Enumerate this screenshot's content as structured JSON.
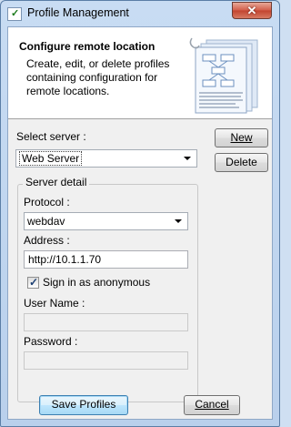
{
  "window": {
    "title": "Profile Management",
    "close_symbol": "✕"
  },
  "header": {
    "title": "Configure remote location",
    "description_lines": [
      "Create, edit, or delete profiles",
      "containing configuration for",
      "remote locations."
    ]
  },
  "server": {
    "label": "Select server :",
    "selected": "Web Server"
  },
  "buttons": {
    "new": "New",
    "delete": "Delete",
    "save": "Save Profiles",
    "cancel": "Cancel"
  },
  "server_detail": {
    "group_label": "Server detail",
    "protocol_label": "Protocol :",
    "protocol_value": "webdav",
    "address_label": "Address :",
    "address_value": "http://10.1.1.70",
    "anonymous_label": "Sign in as anonymous",
    "anonymous_checked": true,
    "username_label": "User Name :",
    "username_value": "",
    "password_label": "Password :",
    "password_value": ""
  }
}
